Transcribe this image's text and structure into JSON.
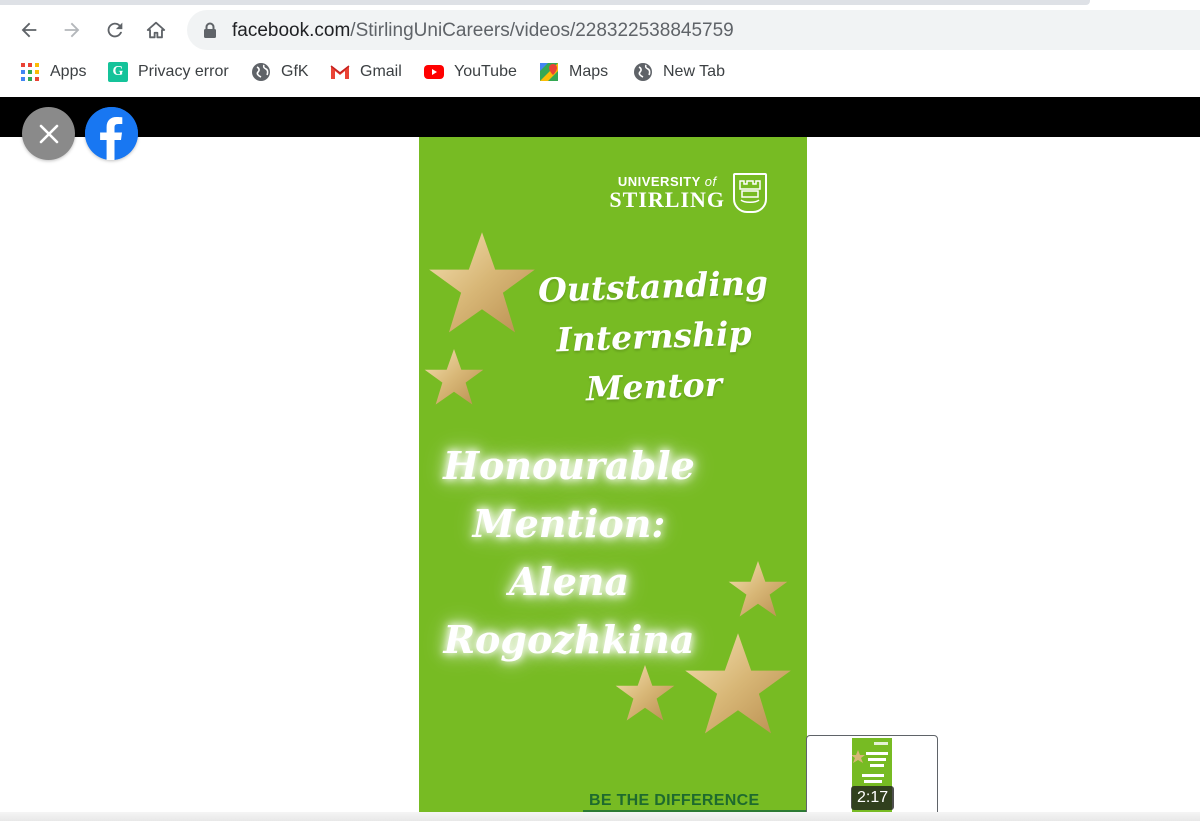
{
  "browser": {
    "url_host": "facebook.com",
    "url_path": "/StirlingUniCareers/videos/228322538845759",
    "bookmarks": [
      {
        "label": "Apps",
        "icon": "apps-grid-icon"
      },
      {
        "label": "Privacy error",
        "icon": "grammarly-icon"
      },
      {
        "label": "GfK",
        "icon": "globe-icon"
      },
      {
        "label": "Gmail",
        "icon": "gmail-icon"
      },
      {
        "label": "YouTube",
        "icon": "youtube-icon"
      },
      {
        "label": "Maps",
        "icon": "maps-icon"
      },
      {
        "label": "New Tab",
        "icon": "globe-icon"
      }
    ]
  },
  "video": {
    "university_line1": "UNIVERSITY",
    "university_of": "of",
    "university_line2": "STIRLING",
    "award_title": [
      "Outstanding",
      "Internship",
      "Mentor"
    ],
    "honourable": [
      "Honourable",
      "Mention:",
      "Alena",
      "Rogozhkina"
    ],
    "tagline": "BE THE DIFFERENCE",
    "background_color": "#77bb23"
  },
  "thumbnail": {
    "duration": "2:17"
  }
}
